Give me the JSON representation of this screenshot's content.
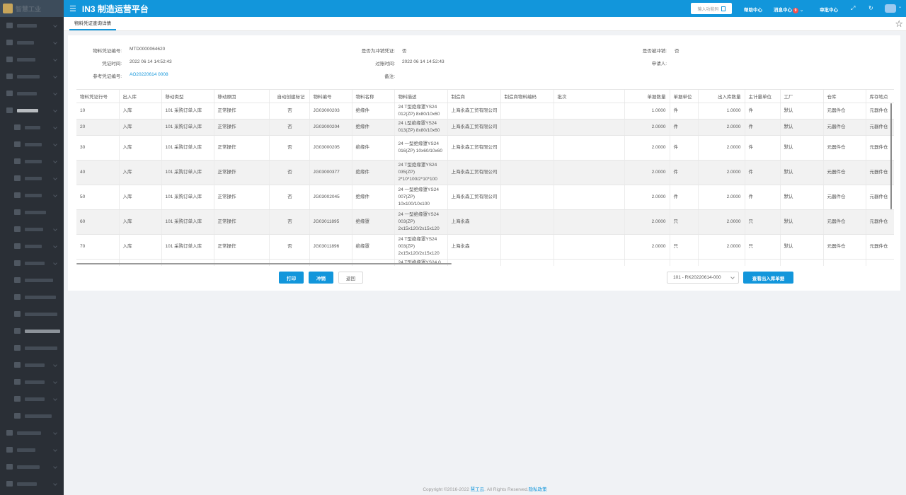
{
  "sidebar": {
    "brand_text": "智慧工业",
    "items": [
      {
        "w": 28,
        "sub": false,
        "arrow": true
      },
      {
        "w": 24,
        "sub": false,
        "arrow": true
      },
      {
        "w": 26,
        "sub": false,
        "arrow": true
      },
      {
        "w": 32,
        "sub": false,
        "arrow": true
      },
      {
        "w": 28,
        "sub": false,
        "arrow": true
      },
      {
        "w": 30,
        "sub": false,
        "arrow": true,
        "open": true
      },
      {
        "w": 22,
        "sub": true,
        "arrow": true
      },
      {
        "w": 24,
        "sub": true,
        "arrow": true
      },
      {
        "w": 24,
        "sub": true,
        "arrow": true
      },
      {
        "w": 24,
        "sub": true,
        "arrow": true
      },
      {
        "w": 24,
        "sub": true,
        "arrow": true
      },
      {
        "w": 30,
        "sub": true,
        "arrow": false
      },
      {
        "w": 26,
        "sub": true,
        "arrow": true
      },
      {
        "w": 24,
        "sub": true,
        "arrow": true
      },
      {
        "w": 28,
        "sub": true,
        "arrow": true
      },
      {
        "w": 40,
        "sub": true,
        "arrow": false
      },
      {
        "w": 44,
        "sub": true,
        "arrow": false
      },
      {
        "w": 46,
        "sub": true,
        "arrow": false
      },
      {
        "w": 50,
        "sub": true,
        "arrow": false,
        "active": true
      },
      {
        "w": 46,
        "sub": true,
        "arrow": false
      },
      {
        "w": 28,
        "sub": true,
        "arrow": true
      },
      {
        "w": 28,
        "sub": true,
        "arrow": true
      },
      {
        "w": 28,
        "sub": true,
        "arrow": true
      },
      {
        "w": 38,
        "sub": true,
        "arrow": false
      },
      {
        "w": 34,
        "sub": false,
        "arrow": true
      },
      {
        "w": 26,
        "sub": false,
        "arrow": true
      },
      {
        "w": 32,
        "sub": false,
        "arrow": true
      },
      {
        "w": 28,
        "sub": false,
        "arrow": true
      }
    ]
  },
  "header": {
    "title": "IN3 制造运营平台",
    "search_placeholder": "输入功能码",
    "help": "帮助中心",
    "messages": "消息中心",
    "message_count": "9",
    "guide": "审批中心"
  },
  "tab": {
    "label": "物料凭证查询详情"
  },
  "info": {
    "voucher_no_label": "物料凭证编号:",
    "voucher_no": "MTD0000064620",
    "is_reversal_label": "是否为冲销凭证:",
    "is_reversal": "否",
    "reversed_label": "是否被冲销:",
    "reversed": "否",
    "voucher_time_label": "凭证时间:",
    "voucher_time": "2022 06 14 14:52:43",
    "posting_time_label": "过账时间:",
    "posting_time": "2022 06 14 14:52:43",
    "applicant_label": "申请人:",
    "applicant": "",
    "ref_no_label": "参考凭证编号:",
    "ref_no": "AO20220614 0008",
    "remark_label": "备注:",
    "remark": ""
  },
  "table": {
    "columns": [
      "物料凭证行号",
      "出入库",
      "移动类型",
      "移动原因",
      "自动创建标记",
      "物料编号",
      "物料名称",
      "物料描述",
      "制造商",
      "制造商物料编码",
      "批次",
      "单据数量",
      "单据单位",
      "出入库数量",
      "主计量单位",
      "工厂",
      "仓库",
      "库存地点"
    ],
    "rows": [
      {
        "line": "10",
        "dir": "入库",
        "type": "101 采购订单入库",
        "reason": "正常操作",
        "auto": "否",
        "code": "JG03000203",
        "name": "绝缘件",
        "desc": "24 T型绝缘罩YS24 012(ZP) 8x80/10x60",
        "mfr": "上海永森工贸有限公司",
        "mfr_code": "",
        "batch": "",
        "qty": "1.0000",
        "unit": "件",
        "io_qty": "1.0000",
        "base_unit": "件",
        "plant": "默认",
        "wh": "元器件仓",
        "loc": "元器件仓"
      },
      {
        "line": "20",
        "dir": "入库",
        "type": "101 采购订单入库",
        "reason": "正常操作",
        "auto": "否",
        "code": "JG03000204",
        "name": "绝缘件",
        "desc": "24 L型绝缘罩YS24 013(ZP) 8x80/10x60",
        "mfr": "上海永森工贸有限公司",
        "mfr_code": "",
        "batch": "",
        "qty": "2.0000",
        "unit": "件",
        "io_qty": "2.0000",
        "base_unit": "件",
        "plant": "默认",
        "wh": "元器件仓",
        "loc": "元器件仓"
      },
      {
        "line": "30",
        "dir": "入库",
        "type": "101 采购订单入库",
        "reason": "正常操作",
        "auto": "否",
        "code": "JG03000205",
        "name": "绝缘件",
        "desc": "24 一型绝缘罩YS24 016(ZP) 10x60/10x60",
        "mfr": "上海永森工贸有限公司",
        "mfr_code": "",
        "batch": "",
        "qty": "2.0000",
        "unit": "件",
        "io_qty": "2.0000",
        "base_unit": "件",
        "plant": "默认",
        "wh": "元器件仓",
        "loc": "元器件仓"
      },
      {
        "line": "40",
        "dir": "入库",
        "type": "101 采购订单入库",
        "reason": "正常操作",
        "auto": "否",
        "code": "JG03000377",
        "name": "绝缘件",
        "desc": "24 T型绝缘罩YS24 035(ZP) 2*10*100/2*10*100",
        "mfr": "上海永森工贸有限公司",
        "mfr_code": "",
        "batch": "",
        "qty": "2.0000",
        "unit": "件",
        "io_qty": "2.0000",
        "base_unit": "件",
        "plant": "默认",
        "wh": "元器件仓",
        "loc": "元器件仓"
      },
      {
        "line": "50",
        "dir": "入库",
        "type": "101 采购订单入库",
        "reason": "正常操作",
        "auto": "否",
        "code": "JG03002045",
        "name": "绝缘件",
        "desc": "24 一型绝缘罩YS24 007(ZP) 10x100/10x100",
        "mfr": "上海永森工贸有限公司",
        "mfr_code": "",
        "batch": "",
        "qty": "2.0000",
        "unit": "件",
        "io_qty": "2.0000",
        "base_unit": "件",
        "plant": "默认",
        "wh": "元器件仓",
        "loc": "元器件仓"
      },
      {
        "line": "60",
        "dir": "入库",
        "type": "101 采购订单入库",
        "reason": "正常操作",
        "auto": "否",
        "code": "JG03011895",
        "name": "绝缘罩",
        "desc": "24 一型绝缘罩YS24 003(ZP) 2x15x120/2x15x120",
        "mfr": "上海永森",
        "mfr_code": "",
        "batch": "",
        "qty": "2.0000",
        "unit": "只",
        "io_qty": "2.0000",
        "base_unit": "只",
        "plant": "默认",
        "wh": "元器件仓",
        "loc": "元器件仓"
      },
      {
        "line": "70",
        "dir": "入库",
        "type": "101 采购订单入库",
        "reason": "正常操作",
        "auto": "否",
        "code": "JG03011896",
        "name": "绝缘罩",
        "desc": "24 T型绝缘罩YS24 003(ZP) 2x15x120/2x15x120",
        "mfr": "上海永森",
        "mfr_code": "",
        "batch": "",
        "qty": "2.0000",
        "unit": "只",
        "io_qty": "2.0000",
        "base_unit": "只",
        "plant": "默认",
        "wh": "元器件仓",
        "loc": "元器件仓"
      }
    ],
    "partial_row_desc": "24 T型绝缘罩YS24 0"
  },
  "actions": {
    "print": "打印",
    "reverse": "冲销",
    "back": "返回",
    "select_value": "101 - RK20220614-000",
    "view_docs": "查看出入库单据"
  },
  "footer": {
    "prefix": "Copyright ©2016-2022",
    "company": "慧工云",
    "rights": ". All Rights Reserved.",
    "privacy": "隐私政策"
  },
  "colors": {
    "primary": "#1296db",
    "sidebar": "#2a2f36",
    "badge": "#f5504c"
  }
}
